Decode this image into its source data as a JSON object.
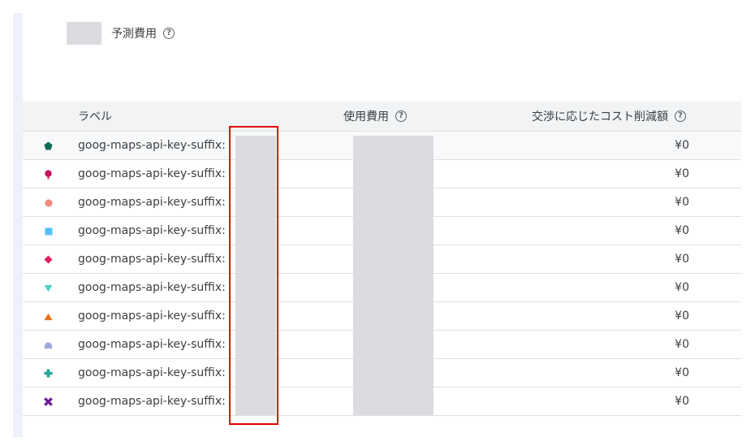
{
  "legend": {
    "label": "予測費用",
    "help": "?"
  },
  "table": {
    "headers": {
      "label": "ラベル",
      "cost": "使用費用",
      "savings": "交渉に応じたコスト削減額",
      "help": "?"
    },
    "rows": [
      {
        "label": "goog-maps-api-key-suffix:",
        "savings": "¥0",
        "marker": "pentagon-icon",
        "color": "#0b6b57"
      },
      {
        "label": "goog-maps-api-key-suffix:",
        "savings": "¥0",
        "marker": "pin-icon",
        "color": "#c2185b"
      },
      {
        "label": "goog-maps-api-key-suffix:",
        "savings": "¥0",
        "marker": "circle-icon",
        "color": "#f28b82"
      },
      {
        "label": "goog-maps-api-key-suffix:",
        "savings": "¥0",
        "marker": "square-icon",
        "color": "#4fc3f7"
      },
      {
        "label": "goog-maps-api-key-suffix:",
        "savings": "¥0",
        "marker": "diamond-icon",
        "color": "#e91e63"
      },
      {
        "label": "goog-maps-api-key-suffix:",
        "savings": "¥0",
        "marker": "triangle-down-icon",
        "color": "#4dd0c8"
      },
      {
        "label": "goog-maps-api-key-suffix:",
        "savings": "¥0",
        "marker": "triangle-up-icon",
        "color": "#e8711c"
      },
      {
        "label": "goog-maps-api-key-suffix:",
        "savings": "¥0",
        "marker": "dome-icon",
        "color": "#9fa8da"
      },
      {
        "label": "goog-maps-api-key-suffix:",
        "savings": "¥0",
        "marker": "plus-icon",
        "color": "#26a69a"
      },
      {
        "label": "goog-maps-api-key-suffix:",
        "savings": "¥0",
        "marker": "cross-icon",
        "color": "#6a1b9a"
      }
    ]
  },
  "highlight_color": "#e00000"
}
